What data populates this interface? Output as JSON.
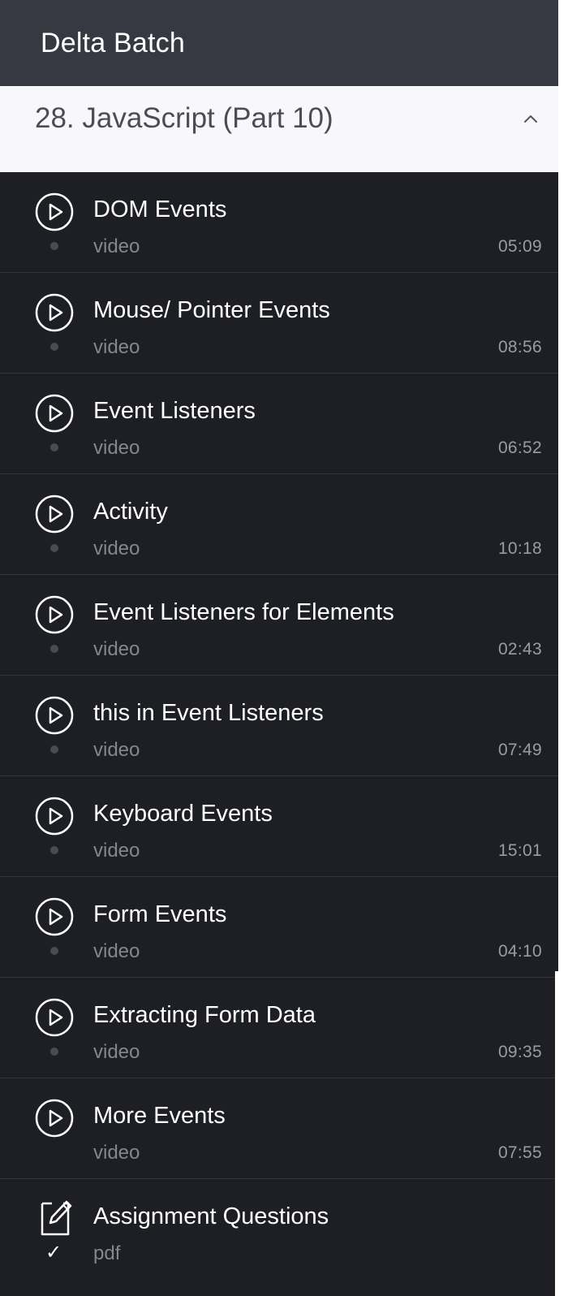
{
  "header": {
    "title": "Delta Batch"
  },
  "section": {
    "title": "28. JavaScript (Part 10)",
    "expanded": true
  },
  "colors": {
    "header_bg": "#363941",
    "section_bg": "#f8f8fc",
    "list_bg": "#1e1f24",
    "text_primary": "#ffffff",
    "text_secondary": "#85878e"
  },
  "items": [
    {
      "title": "DOM Events",
      "type": "video",
      "duration": "05:09",
      "icon": "play-circle-icon"
    },
    {
      "title": "Mouse/ Pointer Events",
      "type": "video",
      "duration": "08:56",
      "icon": "play-circle-icon"
    },
    {
      "title": "Event Listeners",
      "type": "video",
      "duration": "06:52",
      "icon": "play-circle-icon"
    },
    {
      "title": "Activity",
      "type": "video",
      "duration": "10:18",
      "icon": "play-circle-icon"
    },
    {
      "title": "Event Listeners for Elements",
      "type": "video",
      "duration": "02:43",
      "icon": "play-circle-icon"
    },
    {
      "title": "this in Event Listeners",
      "type": "video",
      "duration": "07:49",
      "icon": "play-circle-icon"
    },
    {
      "title": "Keyboard Events",
      "type": "video",
      "duration": "15:01",
      "icon": "play-circle-icon"
    },
    {
      "title": "Form Events",
      "type": "video",
      "duration": "04:10",
      "icon": "play-circle-icon"
    },
    {
      "title": "Extracting Form Data",
      "type": "video",
      "duration": "09:35",
      "icon": "play-circle-icon"
    },
    {
      "title": "More Events",
      "type": "video",
      "duration": "07:55",
      "icon": "play-circle-icon"
    },
    {
      "title": "Assignment Questions",
      "type": "pdf",
      "duration": "",
      "icon": "assignment-edit-icon",
      "completed_mark": "✓"
    }
  ]
}
